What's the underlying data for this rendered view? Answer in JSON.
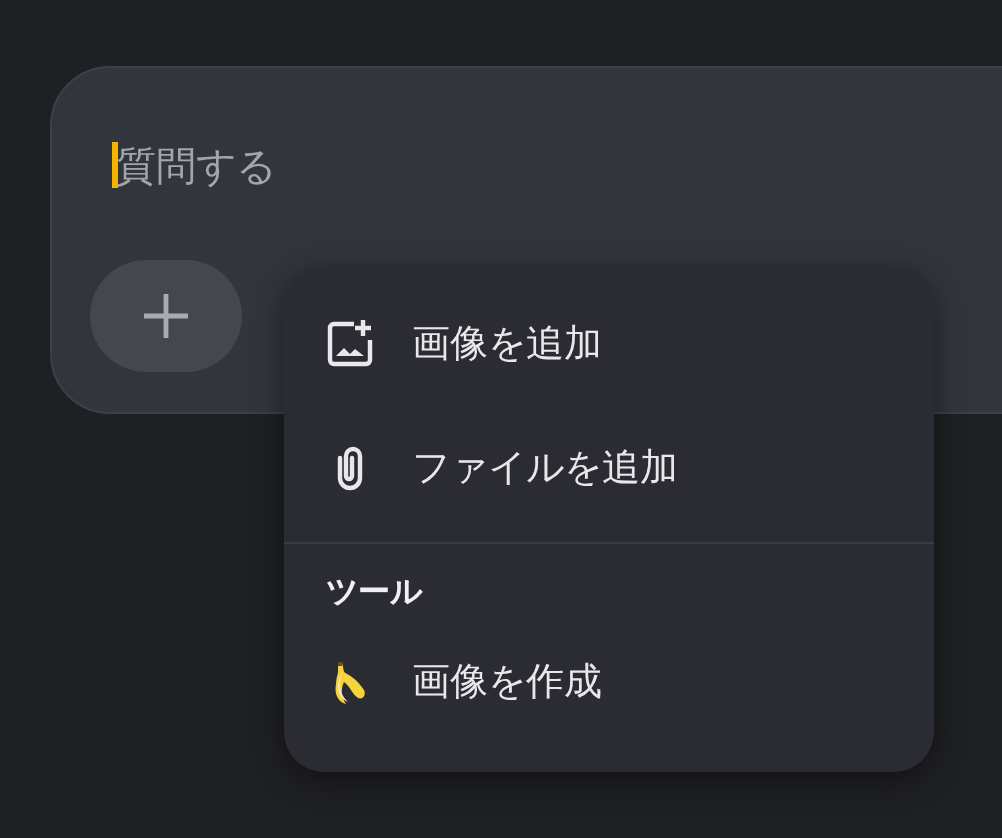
{
  "prompt": {
    "placeholder": "質問する",
    "focused": true
  },
  "menu": {
    "items": [
      {
        "kind": "image",
        "label": "画像を追加"
      },
      {
        "kind": "file",
        "label": "ファイルを追加"
      }
    ],
    "sections": [
      {
        "title": "ツール",
        "items": [
          {
            "kind": "banana",
            "label": "画像を作成"
          }
        ]
      }
    ]
  }
}
